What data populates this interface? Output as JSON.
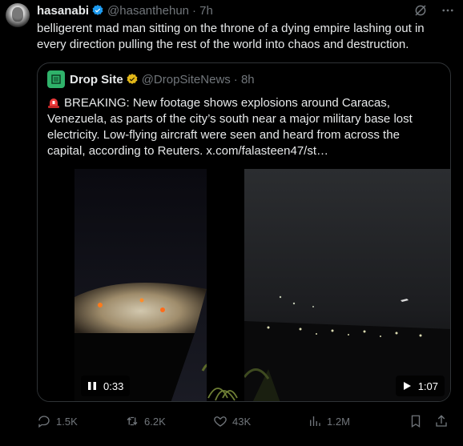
{
  "tweet": {
    "author_name": "hasanabi",
    "author_handle": "@hasanthehun",
    "time": "· 7h",
    "text": "belligerent mad man sitting on the throne of a dying empire lashing out in every direction pulling the rest of the world into chaos and destruction."
  },
  "quoted": {
    "author_name": "Drop Site",
    "author_handle": "@DropSiteNews",
    "time": "· 8h",
    "text": "BREAKING: New footage shows explosions around Caracas, Venezuela, as parts of the city’s south near a major military base lost electricity. Low-flying aircraft were seen and heard from across the capital, according to Reuters.  x.com/falasteen47/st…",
    "videos": [
      {
        "duration": "0:33",
        "state": "pause"
      },
      {
        "duration": "1:07",
        "state": "play"
      }
    ]
  },
  "actions": {
    "replies": "1.5K",
    "reposts": "6.2K",
    "likes": "43K",
    "views": "1.2M"
  },
  "colors": {
    "background": "#000000",
    "text": "#e7e9ea",
    "muted": "#71767b",
    "verified_blue": "#1d9bf0",
    "verified_gold": "#e2b719",
    "border": "#2f3336"
  },
  "icons": [
    "verified-icon",
    "grok-icon",
    "more-icon",
    "siren-icon",
    "pause-icon",
    "play-icon",
    "reply-icon",
    "repost-icon",
    "like-icon",
    "views-icon",
    "bookmark-icon",
    "share-icon"
  ]
}
